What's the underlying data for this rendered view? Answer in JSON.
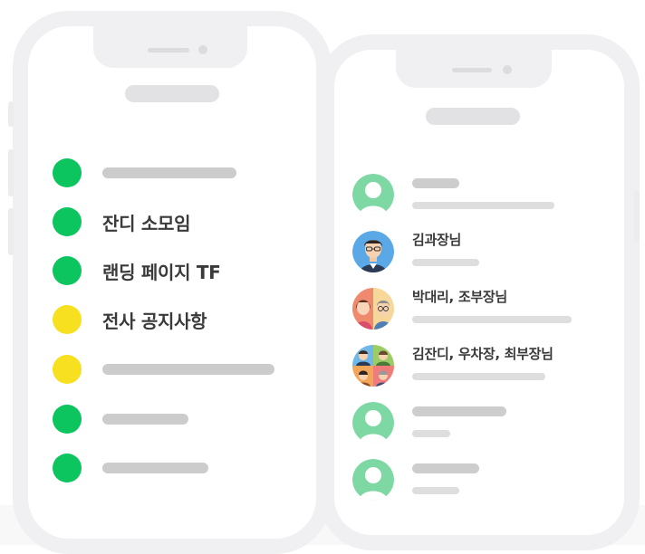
{
  "colors": {
    "frame": "#f0f0f2",
    "green": "#0dc55f",
    "yellow": "#f7e020",
    "placeholder": "#cccccc",
    "avatar_green": "#7ed8a4"
  },
  "left_phone": {
    "rows": [
      {
        "dot": "green",
        "label": null
      },
      {
        "dot": "green",
        "label": "잔디 소모임"
      },
      {
        "dot": "green",
        "label": "랜딩 페이지 TF"
      },
      {
        "dot": "yellow",
        "label": "전사 공지사항"
      },
      {
        "dot": "yellow",
        "label": null
      },
      {
        "dot": "green",
        "label": null
      },
      {
        "dot": "green",
        "label": null
      }
    ]
  },
  "right_phone": {
    "chats": [
      {
        "avatar": "person-silhouette-icon",
        "name": null
      },
      {
        "avatar": "man-with-glasses-avatar",
        "name": "김과장님"
      },
      {
        "avatar": "group-of-two-avatar",
        "name": "박대리, 조부장님"
      },
      {
        "avatar": "group-of-four-avatar",
        "name": "김잔디, 우차장, 최부장님"
      },
      {
        "avatar": "person-silhouette-icon",
        "name": null
      },
      {
        "avatar": "person-silhouette-icon",
        "name": null
      }
    ]
  }
}
